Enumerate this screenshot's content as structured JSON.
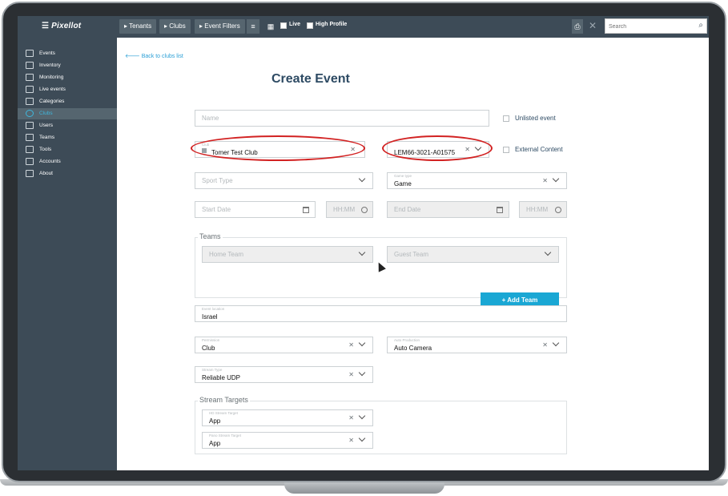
{
  "topbar": {
    "logo": "Pixellot",
    "crumbs": [
      "Tenants",
      "Clubs",
      "Event Filters"
    ],
    "live_label": "Live",
    "high_profile_label": "High Profile",
    "search_placeholder": "Search"
  },
  "sidebar": {
    "items": [
      {
        "label": "Events"
      },
      {
        "label": "Inventory"
      },
      {
        "label": "Monitoring"
      },
      {
        "label": "Live events"
      },
      {
        "label": "Categories"
      },
      {
        "label": "Clubs",
        "active": true
      },
      {
        "label": "Users"
      },
      {
        "label": "Teams"
      },
      {
        "label": "Tools"
      },
      {
        "label": "Accounts"
      },
      {
        "label": "About"
      }
    ]
  },
  "main": {
    "back_link": "Back to clubs list",
    "title": "Create Event",
    "name_placeholder": "Name",
    "unlisted_label": "Unlisted event",
    "club_small_label": "Club",
    "club_value": "Tomer Test Club",
    "system_value": "LEM66-3021-A01575",
    "external_label": "External Content",
    "sport_placeholder": "Sport Type",
    "game_type_label": "Game type",
    "game_type_value": "Game",
    "start_date_placeholder": "Start Date",
    "start_time_placeholder": "HH:MM",
    "end_date_placeholder": "End Date",
    "end_time_placeholder": "HH:MM",
    "teams_legend": "Teams",
    "home_team_placeholder": "Home Team",
    "guest_team_placeholder": "Guest Team",
    "add_team_label": "+ Add Team",
    "event_location_label": "Event location",
    "event_location_value": "Israel",
    "permission_label": "Permission",
    "permission_value": "Club",
    "auto_production_label": "Auto Production",
    "auto_production_value": "Auto Camera",
    "stream_type_label": "Stream Type",
    "stream_type_value": "Reliable UDP",
    "stream_targets_legend": "Stream Targets",
    "hd_target_label": "HD Stream Target",
    "hd_target_value": "App",
    "pano_target_label": "Pano Stream Target",
    "pano_target_value": "App"
  },
  "colors": {
    "topbar": "#3d4b57",
    "accent": "#1aa7d4",
    "highlight_ellipse": "#d22222"
  }
}
